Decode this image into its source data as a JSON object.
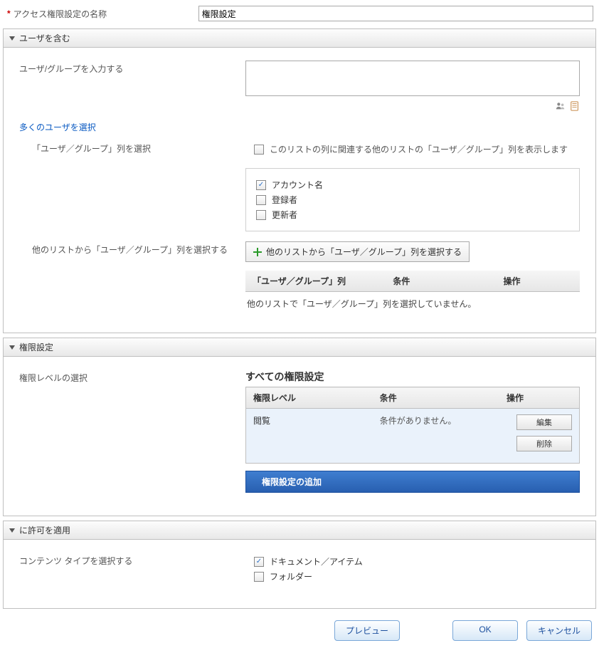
{
  "name_field": {
    "label": "アクセス権限設定の名称",
    "value": "権限設定"
  },
  "section_users": {
    "title": "ユーザを含む",
    "input_label": "ユーザ/グループを入力する",
    "more_link": "多くのユーザを選択",
    "col_select_label": "「ユーザ／グループ」列を選択",
    "related_checkbox": "このリストの列に関連する他のリストの「ユーザ／グループ」列を表示します",
    "fields": {
      "account": {
        "label": "アカウント名",
        "checked": true
      },
      "registrar": {
        "label": "登録者",
        "checked": false
      },
      "updater": {
        "label": "更新者",
        "checked": false
      }
    },
    "other_list_label": "他のリストから「ユーザ／グループ」列を選択する",
    "other_list_button": "他のリストから「ユーザ／グループ」列を選択する",
    "grid": {
      "cols": [
        "「ユーザ／グループ」列",
        "条件",
        "操作"
      ],
      "empty": "他のリストで「ユーザ／グループ」列を選択していません。"
    }
  },
  "section_perm": {
    "title": "権限設定",
    "level_label": "権限レベルの選択",
    "all_heading": "すべての権限設定",
    "cols": [
      "権限レベル",
      "条件",
      "操作"
    ],
    "row": {
      "level": "閲覧",
      "cond": "条件がありません。",
      "edit": "編集",
      "delete": "削除"
    },
    "add_button": "権限設定の追加"
  },
  "section_apply": {
    "title": "に許可を適用",
    "content_type_label": "コンテンツ タイプを選択する",
    "doc_item": {
      "label": "ドキュメント／アイテム",
      "checked": true
    },
    "folder": {
      "label": "フォルダー",
      "checked": false
    }
  },
  "footer": {
    "preview": "プレビュー",
    "ok": "OK",
    "cancel": "キャンセル"
  }
}
